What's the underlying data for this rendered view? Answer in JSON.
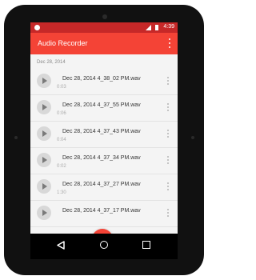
{
  "status_bar": {
    "time": "4:39"
  },
  "toolbar": {
    "title": "Audio Recorder",
    "menu_icon": "more-vert-icon"
  },
  "list": {
    "section_header": "Dec 28, 2014",
    "items": [
      {
        "name": "Dec 28, 2014 4_38_02 PM.wav",
        "duration": "0:03"
      },
      {
        "name": "Dec 28, 2014 4_37_55 PM.wav",
        "duration": "0:06"
      },
      {
        "name": "Dec 28, 2014 4_37_43 PM.wav",
        "duration": "0:04"
      },
      {
        "name": "Dec 28, 2014 4_37_34 PM.wav",
        "duration": "0:02"
      },
      {
        "name": "Dec 28, 2014 4_37_27 PM.wav",
        "duration": "1:30"
      },
      {
        "name": "Dec 28, 2014 4_37_17 PM.wav",
        "duration": ""
      }
    ]
  },
  "bottom_bar": {
    "left_icon": "settings-icon",
    "center_icon": "mic-icon",
    "right_icon": "watch-icon"
  },
  "nav_bar": {
    "icons": [
      "back-icon",
      "home-icon",
      "recents-icon"
    ]
  },
  "colors": {
    "primary": "#f44336",
    "primary_dark": "#c62828",
    "list_bg": "#f4f4f4"
  }
}
